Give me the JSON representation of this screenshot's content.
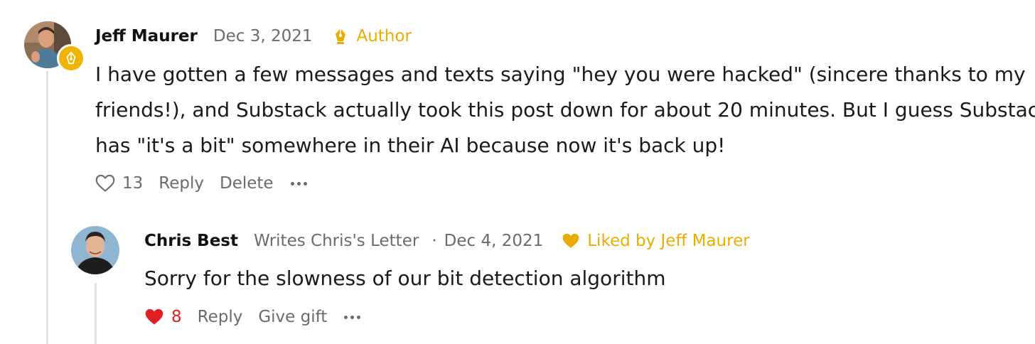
{
  "comments": [
    {
      "author": "Jeff Maurer",
      "date": "Dec 3, 2021",
      "badge_label": "Author",
      "body_lines": [
        "I have gotten a few messages and texts saying \"hey you were hacked\" (sincere thanks to my",
        "friends!), and Substack actually took this post down for about 20 minutes. But I guess Substack",
        "has \"it's a bit\" somewhere in their AI because now it's back up!"
      ],
      "like_count": "13",
      "reply_label": "Reply",
      "delete_label": "Delete",
      "liked": false
    },
    {
      "author": "Chris Best",
      "subtitle": "Writes Chris's Letter",
      "separator": "·",
      "date": "Dec 4, 2021",
      "liked_by_label": "Liked by Jeff Maurer",
      "body": "Sorry for the slowness of our bit detection algorithm",
      "like_count": "8",
      "reply_label": "Reply",
      "gift_label": "Give gift",
      "liked": true
    }
  ],
  "colors": {
    "accent_gold": "#e8ad00",
    "heart_red": "#e02020",
    "muted_text": "#6b6b6b",
    "thread_line": "#e2e2e2"
  },
  "icons": {
    "author_badge": "pen-nib-icon",
    "like": "heart-icon",
    "more": "more-dots-icon"
  }
}
